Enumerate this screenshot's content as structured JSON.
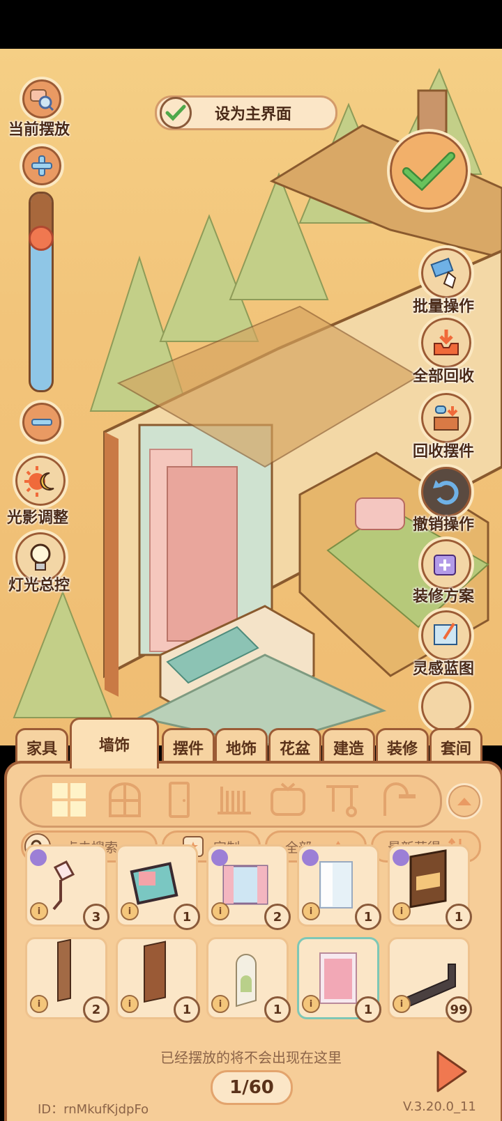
{
  "header": {
    "set_main_label": "设为主界面"
  },
  "left_controls": {
    "current_placement": "当前摆放",
    "light_shadow": "光影调整",
    "light_master": "灯光总控",
    "zoom_level": 0.22
  },
  "right_controls": {
    "batch": "批量操作",
    "recycle_all": "全部回收",
    "recycle_items": "回收摆件",
    "undo": "撤销操作",
    "scheme": "装修方案",
    "blueprint": "灵感蓝图"
  },
  "tabs": [
    "家具",
    "墙饰",
    "摆件",
    "地饰",
    "花盆",
    "建造",
    "装修",
    "套间"
  ],
  "active_tab": "墙饰",
  "filters": {
    "search_placeholder": "点击搜索",
    "custom": "定制",
    "all": "全部",
    "sort": "最新获得"
  },
  "items": [
    {
      "count": "3",
      "blueprint": true,
      "kind": "lamp"
    },
    {
      "count": "1",
      "blueprint": false,
      "kind": "painting"
    },
    {
      "count": "2",
      "blueprint": true,
      "kind": "window"
    },
    {
      "count": "1",
      "blueprint": true,
      "kind": "window-curtain"
    },
    {
      "count": "1",
      "blueprint": true,
      "kind": "shelf-window"
    },
    {
      "count": "2",
      "blueprint": false,
      "kind": "door-slim"
    },
    {
      "count": "1",
      "blueprint": false,
      "kind": "door"
    },
    {
      "count": "1",
      "blueprint": false,
      "kind": "arch-door"
    },
    {
      "count": "1",
      "blueprint": false,
      "kind": "curtain",
      "selected": true
    },
    {
      "count": "99",
      "blueprint": false,
      "kind": "wall-piece"
    }
  ],
  "footer": {
    "hint": "已经摆放的将不会出现在这里",
    "page": "1/60",
    "id": "ID：rnMkufKjdpFo",
    "version": "V.3.20.0_11"
  },
  "colors": {
    "accent": "#e99a63",
    "panel": "#f6cd98",
    "border": "#a26038",
    "check": "#4fa84a"
  }
}
